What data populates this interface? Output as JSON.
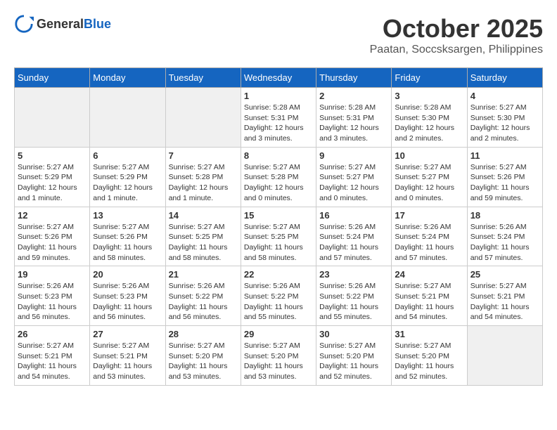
{
  "header": {
    "logo_general": "General",
    "logo_blue": "Blue",
    "title": "October 2025",
    "subtitle": "Paatan, Soccsksargen, Philippines"
  },
  "calendar": {
    "days_of_week": [
      "Sunday",
      "Monday",
      "Tuesday",
      "Wednesday",
      "Thursday",
      "Friday",
      "Saturday"
    ],
    "weeks": [
      {
        "days": [
          {
            "num": "",
            "sunrise": "",
            "sunset": "",
            "daylight": ""
          },
          {
            "num": "",
            "sunrise": "",
            "sunset": "",
            "daylight": ""
          },
          {
            "num": "",
            "sunrise": "",
            "sunset": "",
            "daylight": ""
          },
          {
            "num": "1",
            "sunrise": "Sunrise: 5:28 AM",
            "sunset": "Sunset: 5:31 PM",
            "daylight": "Daylight: 12 hours and 3 minutes."
          },
          {
            "num": "2",
            "sunrise": "Sunrise: 5:28 AM",
            "sunset": "Sunset: 5:31 PM",
            "daylight": "Daylight: 12 hours and 3 minutes."
          },
          {
            "num": "3",
            "sunrise": "Sunrise: 5:28 AM",
            "sunset": "Sunset: 5:30 PM",
            "daylight": "Daylight: 12 hours and 2 minutes."
          },
          {
            "num": "4",
            "sunrise": "Sunrise: 5:27 AM",
            "sunset": "Sunset: 5:30 PM",
            "daylight": "Daylight: 12 hours and 2 minutes."
          }
        ]
      },
      {
        "days": [
          {
            "num": "5",
            "sunrise": "Sunrise: 5:27 AM",
            "sunset": "Sunset: 5:29 PM",
            "daylight": "Daylight: 12 hours and 1 minute."
          },
          {
            "num": "6",
            "sunrise": "Sunrise: 5:27 AM",
            "sunset": "Sunset: 5:29 PM",
            "daylight": "Daylight: 12 hours and 1 minute."
          },
          {
            "num": "7",
            "sunrise": "Sunrise: 5:27 AM",
            "sunset": "Sunset: 5:28 PM",
            "daylight": "Daylight: 12 hours and 1 minute."
          },
          {
            "num": "8",
            "sunrise": "Sunrise: 5:27 AM",
            "sunset": "Sunset: 5:28 PM",
            "daylight": "Daylight: 12 hours and 0 minutes."
          },
          {
            "num": "9",
            "sunrise": "Sunrise: 5:27 AM",
            "sunset": "Sunset: 5:27 PM",
            "daylight": "Daylight: 12 hours and 0 minutes."
          },
          {
            "num": "10",
            "sunrise": "Sunrise: 5:27 AM",
            "sunset": "Sunset: 5:27 PM",
            "daylight": "Daylight: 12 hours and 0 minutes."
          },
          {
            "num": "11",
            "sunrise": "Sunrise: 5:27 AM",
            "sunset": "Sunset: 5:26 PM",
            "daylight": "Daylight: 11 hours and 59 minutes."
          }
        ]
      },
      {
        "days": [
          {
            "num": "12",
            "sunrise": "Sunrise: 5:27 AM",
            "sunset": "Sunset: 5:26 PM",
            "daylight": "Daylight: 11 hours and 59 minutes."
          },
          {
            "num": "13",
            "sunrise": "Sunrise: 5:27 AM",
            "sunset": "Sunset: 5:26 PM",
            "daylight": "Daylight: 11 hours and 58 minutes."
          },
          {
            "num": "14",
            "sunrise": "Sunrise: 5:27 AM",
            "sunset": "Sunset: 5:25 PM",
            "daylight": "Daylight: 11 hours and 58 minutes."
          },
          {
            "num": "15",
            "sunrise": "Sunrise: 5:27 AM",
            "sunset": "Sunset: 5:25 PM",
            "daylight": "Daylight: 11 hours and 58 minutes."
          },
          {
            "num": "16",
            "sunrise": "Sunrise: 5:26 AM",
            "sunset": "Sunset: 5:24 PM",
            "daylight": "Daylight: 11 hours and 57 minutes."
          },
          {
            "num": "17",
            "sunrise": "Sunrise: 5:26 AM",
            "sunset": "Sunset: 5:24 PM",
            "daylight": "Daylight: 11 hours and 57 minutes."
          },
          {
            "num": "18",
            "sunrise": "Sunrise: 5:26 AM",
            "sunset": "Sunset: 5:24 PM",
            "daylight": "Daylight: 11 hours and 57 minutes."
          }
        ]
      },
      {
        "days": [
          {
            "num": "19",
            "sunrise": "Sunrise: 5:26 AM",
            "sunset": "Sunset: 5:23 PM",
            "daylight": "Daylight: 11 hours and 56 minutes."
          },
          {
            "num": "20",
            "sunrise": "Sunrise: 5:26 AM",
            "sunset": "Sunset: 5:23 PM",
            "daylight": "Daylight: 11 hours and 56 minutes."
          },
          {
            "num": "21",
            "sunrise": "Sunrise: 5:26 AM",
            "sunset": "Sunset: 5:22 PM",
            "daylight": "Daylight: 11 hours and 56 minutes."
          },
          {
            "num": "22",
            "sunrise": "Sunrise: 5:26 AM",
            "sunset": "Sunset: 5:22 PM",
            "daylight": "Daylight: 11 hours and 55 minutes."
          },
          {
            "num": "23",
            "sunrise": "Sunrise: 5:26 AM",
            "sunset": "Sunset: 5:22 PM",
            "daylight": "Daylight: 11 hours and 55 minutes."
          },
          {
            "num": "24",
            "sunrise": "Sunrise: 5:27 AM",
            "sunset": "Sunset: 5:21 PM",
            "daylight": "Daylight: 11 hours and 54 minutes."
          },
          {
            "num": "25",
            "sunrise": "Sunrise: 5:27 AM",
            "sunset": "Sunset: 5:21 PM",
            "daylight": "Daylight: 11 hours and 54 minutes."
          }
        ]
      },
      {
        "days": [
          {
            "num": "26",
            "sunrise": "Sunrise: 5:27 AM",
            "sunset": "Sunset: 5:21 PM",
            "daylight": "Daylight: 11 hours and 54 minutes."
          },
          {
            "num": "27",
            "sunrise": "Sunrise: 5:27 AM",
            "sunset": "Sunset: 5:21 PM",
            "daylight": "Daylight: 11 hours and 53 minutes."
          },
          {
            "num": "28",
            "sunrise": "Sunrise: 5:27 AM",
            "sunset": "Sunset: 5:20 PM",
            "daylight": "Daylight: 11 hours and 53 minutes."
          },
          {
            "num": "29",
            "sunrise": "Sunrise: 5:27 AM",
            "sunset": "Sunset: 5:20 PM",
            "daylight": "Daylight: 11 hours and 53 minutes."
          },
          {
            "num": "30",
            "sunrise": "Sunrise: 5:27 AM",
            "sunset": "Sunset: 5:20 PM",
            "daylight": "Daylight: 11 hours and 52 minutes."
          },
          {
            "num": "31",
            "sunrise": "Sunrise: 5:27 AM",
            "sunset": "Sunset: 5:20 PM",
            "daylight": "Daylight: 11 hours and 52 minutes."
          },
          {
            "num": "",
            "sunrise": "",
            "sunset": "",
            "daylight": ""
          }
        ]
      }
    ]
  }
}
